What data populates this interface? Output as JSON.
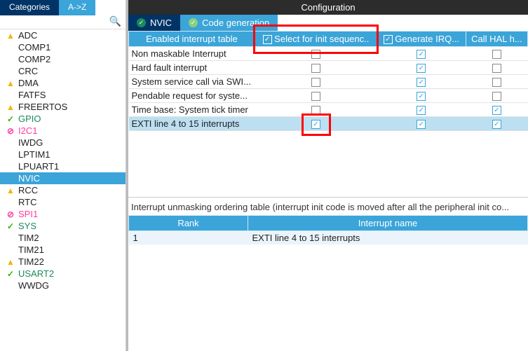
{
  "sidebar": {
    "tabs": [
      {
        "label": "Categories",
        "active": true
      },
      {
        "label": "A->Z",
        "active": false
      }
    ],
    "search_icon": "🔍",
    "items": [
      {
        "icon": "warn",
        "label": "ADC"
      },
      {
        "icon": "",
        "label": "COMP1"
      },
      {
        "icon": "",
        "label": "COMP2"
      },
      {
        "icon": "",
        "label": "CRC"
      },
      {
        "icon": "warn",
        "label": "DMA"
      },
      {
        "icon": "",
        "label": "FATFS"
      },
      {
        "icon": "warn",
        "label": "FREERTOS"
      },
      {
        "icon": "ok",
        "label": "GPIO"
      },
      {
        "icon": "no",
        "label": "I2C1"
      },
      {
        "icon": "",
        "label": "IWDG"
      },
      {
        "icon": "",
        "label": "LPTIM1"
      },
      {
        "icon": "",
        "label": "LPUART1"
      },
      {
        "icon": "",
        "label": "NVIC",
        "selected": true
      },
      {
        "icon": "warn",
        "label": "RCC"
      },
      {
        "icon": "",
        "label": "RTC"
      },
      {
        "icon": "no",
        "label": "SPI1"
      },
      {
        "icon": "ok",
        "label": "SYS"
      },
      {
        "icon": "",
        "label": "TIM2"
      },
      {
        "icon": "",
        "label": "TIM21"
      },
      {
        "icon": "warn",
        "label": "TIM22"
      },
      {
        "icon": "ok",
        "label": "USART2"
      },
      {
        "icon": "",
        "label": "WWDG"
      }
    ]
  },
  "config": {
    "title": "Configuration",
    "tabs": [
      {
        "label": "NVIC",
        "active": true
      },
      {
        "label": "Code generation",
        "active": false
      }
    ],
    "cols": [
      "Enabled interrupt table",
      "Select for init sequenc..",
      "Generate IRQ...",
      "Call HAL h..."
    ],
    "col_chk": [
      null,
      true,
      true,
      null
    ],
    "rows": [
      {
        "label": "Non maskable Interrupt",
        "c": [
          false,
          true,
          false
        ]
      },
      {
        "label": "Hard fault interrupt",
        "c": [
          false,
          true,
          false
        ]
      },
      {
        "label": "System service call via SWI...",
        "c": [
          false,
          true,
          false
        ]
      },
      {
        "label": "Pendable request for syste...",
        "c": [
          false,
          true,
          false
        ]
      },
      {
        "label": "Time base: System tick timer",
        "c": [
          false,
          true,
          true
        ]
      },
      {
        "label": "EXTI line 4 to 15 interrupts",
        "c": [
          true,
          true,
          true
        ],
        "sel": true
      }
    ],
    "note": "Interrupt unmasking ordering table (interrupt init code is moved after all the peripheral init co...",
    "ordering": {
      "cols": [
        "Rank",
        "Interrupt name"
      ],
      "rows": [
        {
          "rank": "1",
          "name": "EXTI line 4 to 15 interrupts"
        }
      ]
    }
  }
}
